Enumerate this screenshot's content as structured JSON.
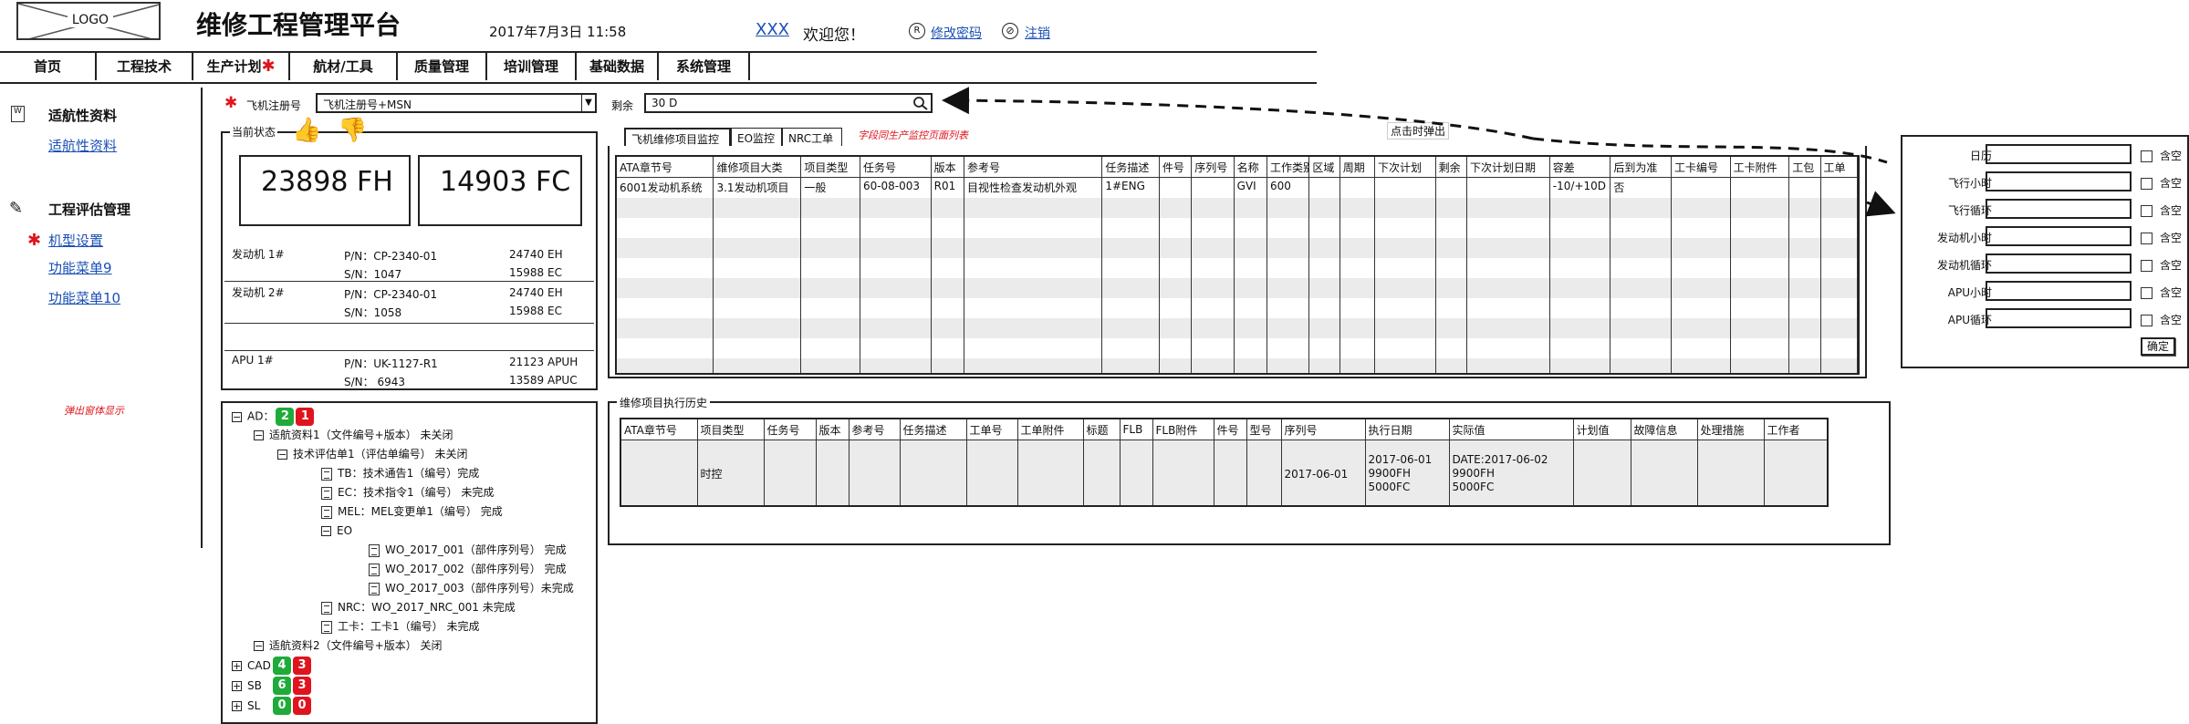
{
  "header": {
    "logo": "LOGO",
    "title": "维修工程管理平台",
    "datetime": "2017年7月3日  11:58",
    "user": "XXX",
    "welcome": "欢迎您！",
    "change_password": "修改密码",
    "logout": "注销"
  },
  "menu": [
    "首页",
    "工程技术",
    "生产计划",
    "航材/工具",
    "质量管理",
    "培训管理",
    "基础数据",
    "系统管理"
  ],
  "sidebar": {
    "section1_title": "适航性资料",
    "section1_link": "适航性资料",
    "section2_title": "工程评估管理",
    "links": [
      "机型设置",
      "功能菜单9",
      "功能菜单10"
    ],
    "popup_note": "弹出窗体显示"
  },
  "filters": {
    "reg_label": "飞机注册号",
    "reg_value": "飞机注册号+MSN",
    "remain_label": "剩余",
    "remain_value": "30 D",
    "popup_hint": "点击时弹出"
  },
  "status": {
    "title": "当前状态",
    "fh": "23898 FH",
    "fc": "14903 FC",
    "engines": [
      {
        "name": "发动机 1#",
        "pn": "P/N：CP-2340-01",
        "sn": "S/N：1047",
        "eh": "24740 EH",
        "ec": "15988 EC"
      },
      {
        "name": "发动机 2#",
        "pn": "P/N：CP-2340-01",
        "sn": "S/N：1058",
        "eh": "24740 EH",
        "ec": "15988 EC"
      }
    ],
    "apu": {
      "name": "APU 1#",
      "pn": "P/N：UK-1127-R1",
      "sn": "S/N： 6943",
      "h": "21123 APUH",
      "c": "13589 APUC"
    }
  },
  "tree": {
    "ad_label": "AD：",
    "ad_green": "2",
    "ad_red": "1",
    "items": [
      "适航资料1（文件编号+版本） 未关闭",
      "技术评估单1（评估单编号） 未关闭",
      "TB：技术通告1（编号）完成",
      "EC：技术指令1（编号） 未完成",
      "MEL：MEL变更单1（编号） 完成",
      "EO",
      "WO_2017_001（部件序列号） 完成",
      "WO_2017_002（部件序列号） 完成",
      "WO_2017_003（部件序列号）未完成",
      "NRC：WO_2017_NRC_001  未完成",
      "工卡：工卡1（编号） 未完成",
      "适航资料2（文件编号+版本） 关闭"
    ],
    "groups": [
      {
        "label": "CAD",
        "green": "4",
        "red": "3"
      },
      {
        "label": "SB",
        "green": "6",
        "red": "3"
      },
      {
        "label": "SL",
        "green": "0",
        "red": "0"
      }
    ]
  },
  "tabs": [
    "飞机维修项目监控",
    "EO监控",
    "NRC工单"
  ],
  "tabs_note": "字段同生产监控页面列表",
  "monitor_table": {
    "headers": [
      "ATA章节号",
      "维修项目大类",
      "项目类型",
      "任务号",
      "版本",
      "参考号",
      "任务描述",
      "件号",
      "序列号",
      "名称",
      "工作类别",
      "区域",
      "周期",
      "下次计划",
      "剩余",
      "下次计划日期",
      "容差",
      "后到为准",
      "工卡编号",
      "工卡附件",
      "工包",
      "工单"
    ],
    "row": [
      "6001发动机系统",
      "3.1发动机项目",
      "一般",
      "60-08-003",
      "R01",
      "目视性检查发动机外观",
      "1#ENG",
      "",
      "",
      "GVI",
      "600",
      "",
      "",
      "",
      "",
      "",
      "-10/+10D",
      "否",
      "",
      "",
      "",
      ""
    ]
  },
  "history": {
    "title": "维修项目执行历史",
    "headers": [
      "ATA章节号",
      "项目类型",
      "任务号",
      "版本",
      "参考号",
      "任务描述",
      "工单号",
      "工单附件",
      "标题",
      "FLB",
      "FLB附件",
      "件号",
      "型号",
      "序列号",
      "执行日期",
      "实际值",
      "计划值",
      "故障信息",
      "处理措施",
      "工作者"
    ],
    "row_type": "时控",
    "serial": "2017-06-01",
    "exec": [
      "2017-06-01",
      "9900FH",
      "5000FC"
    ],
    "actual": [
      "DATE:2017-06-02",
      "9900FH",
      "5000FC"
    ]
  },
  "popup_form": {
    "fields": [
      "日历",
      "飞行小时",
      "飞行循环",
      "发动机小时",
      "发动机循环",
      "APU小时",
      "APU循环"
    ],
    "check_label": "含空",
    "confirm": "确定"
  },
  "colors": {
    "green": "#1faa3a",
    "red": "#e0141e",
    "link": "#1a4fb5",
    "alt_row": "#ebebeb"
  }
}
